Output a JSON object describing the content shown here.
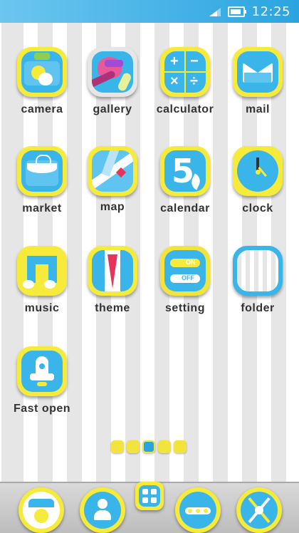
{
  "status_bar": {
    "time": "12:25",
    "battery_level": 0.9,
    "icons": [
      "signal-icon",
      "battery-icon"
    ]
  },
  "apps": [
    {
      "label": "camera"
    },
    {
      "label": "gallery"
    },
    {
      "label": "calculator"
    },
    {
      "label": "mail"
    },
    {
      "label": "market"
    },
    {
      "label": "map"
    },
    {
      "label": "calendar",
      "glyph": "5"
    },
    {
      "label": "clock"
    },
    {
      "label": "music"
    },
    {
      "label": "theme"
    },
    {
      "label": "setting",
      "toggle_on": "ON",
      "toggle_off": "OFF"
    },
    {
      "label": "folder"
    },
    {
      "label": "Fast open"
    }
  ],
  "calculator_glyphs": [
    "+",
    "−",
    "×",
    "÷"
  ],
  "page_indicator": {
    "count": 5,
    "active_index": 2
  },
  "dock": [
    "phone-icon",
    "contacts-icon",
    "app-drawer-icon",
    "messages-icon",
    "browser-icon"
  ],
  "colors": {
    "accent_blue": "#39b5ea",
    "frame_yellow": "#f6ea3a",
    "status_blue": "#2aa4e0"
  }
}
